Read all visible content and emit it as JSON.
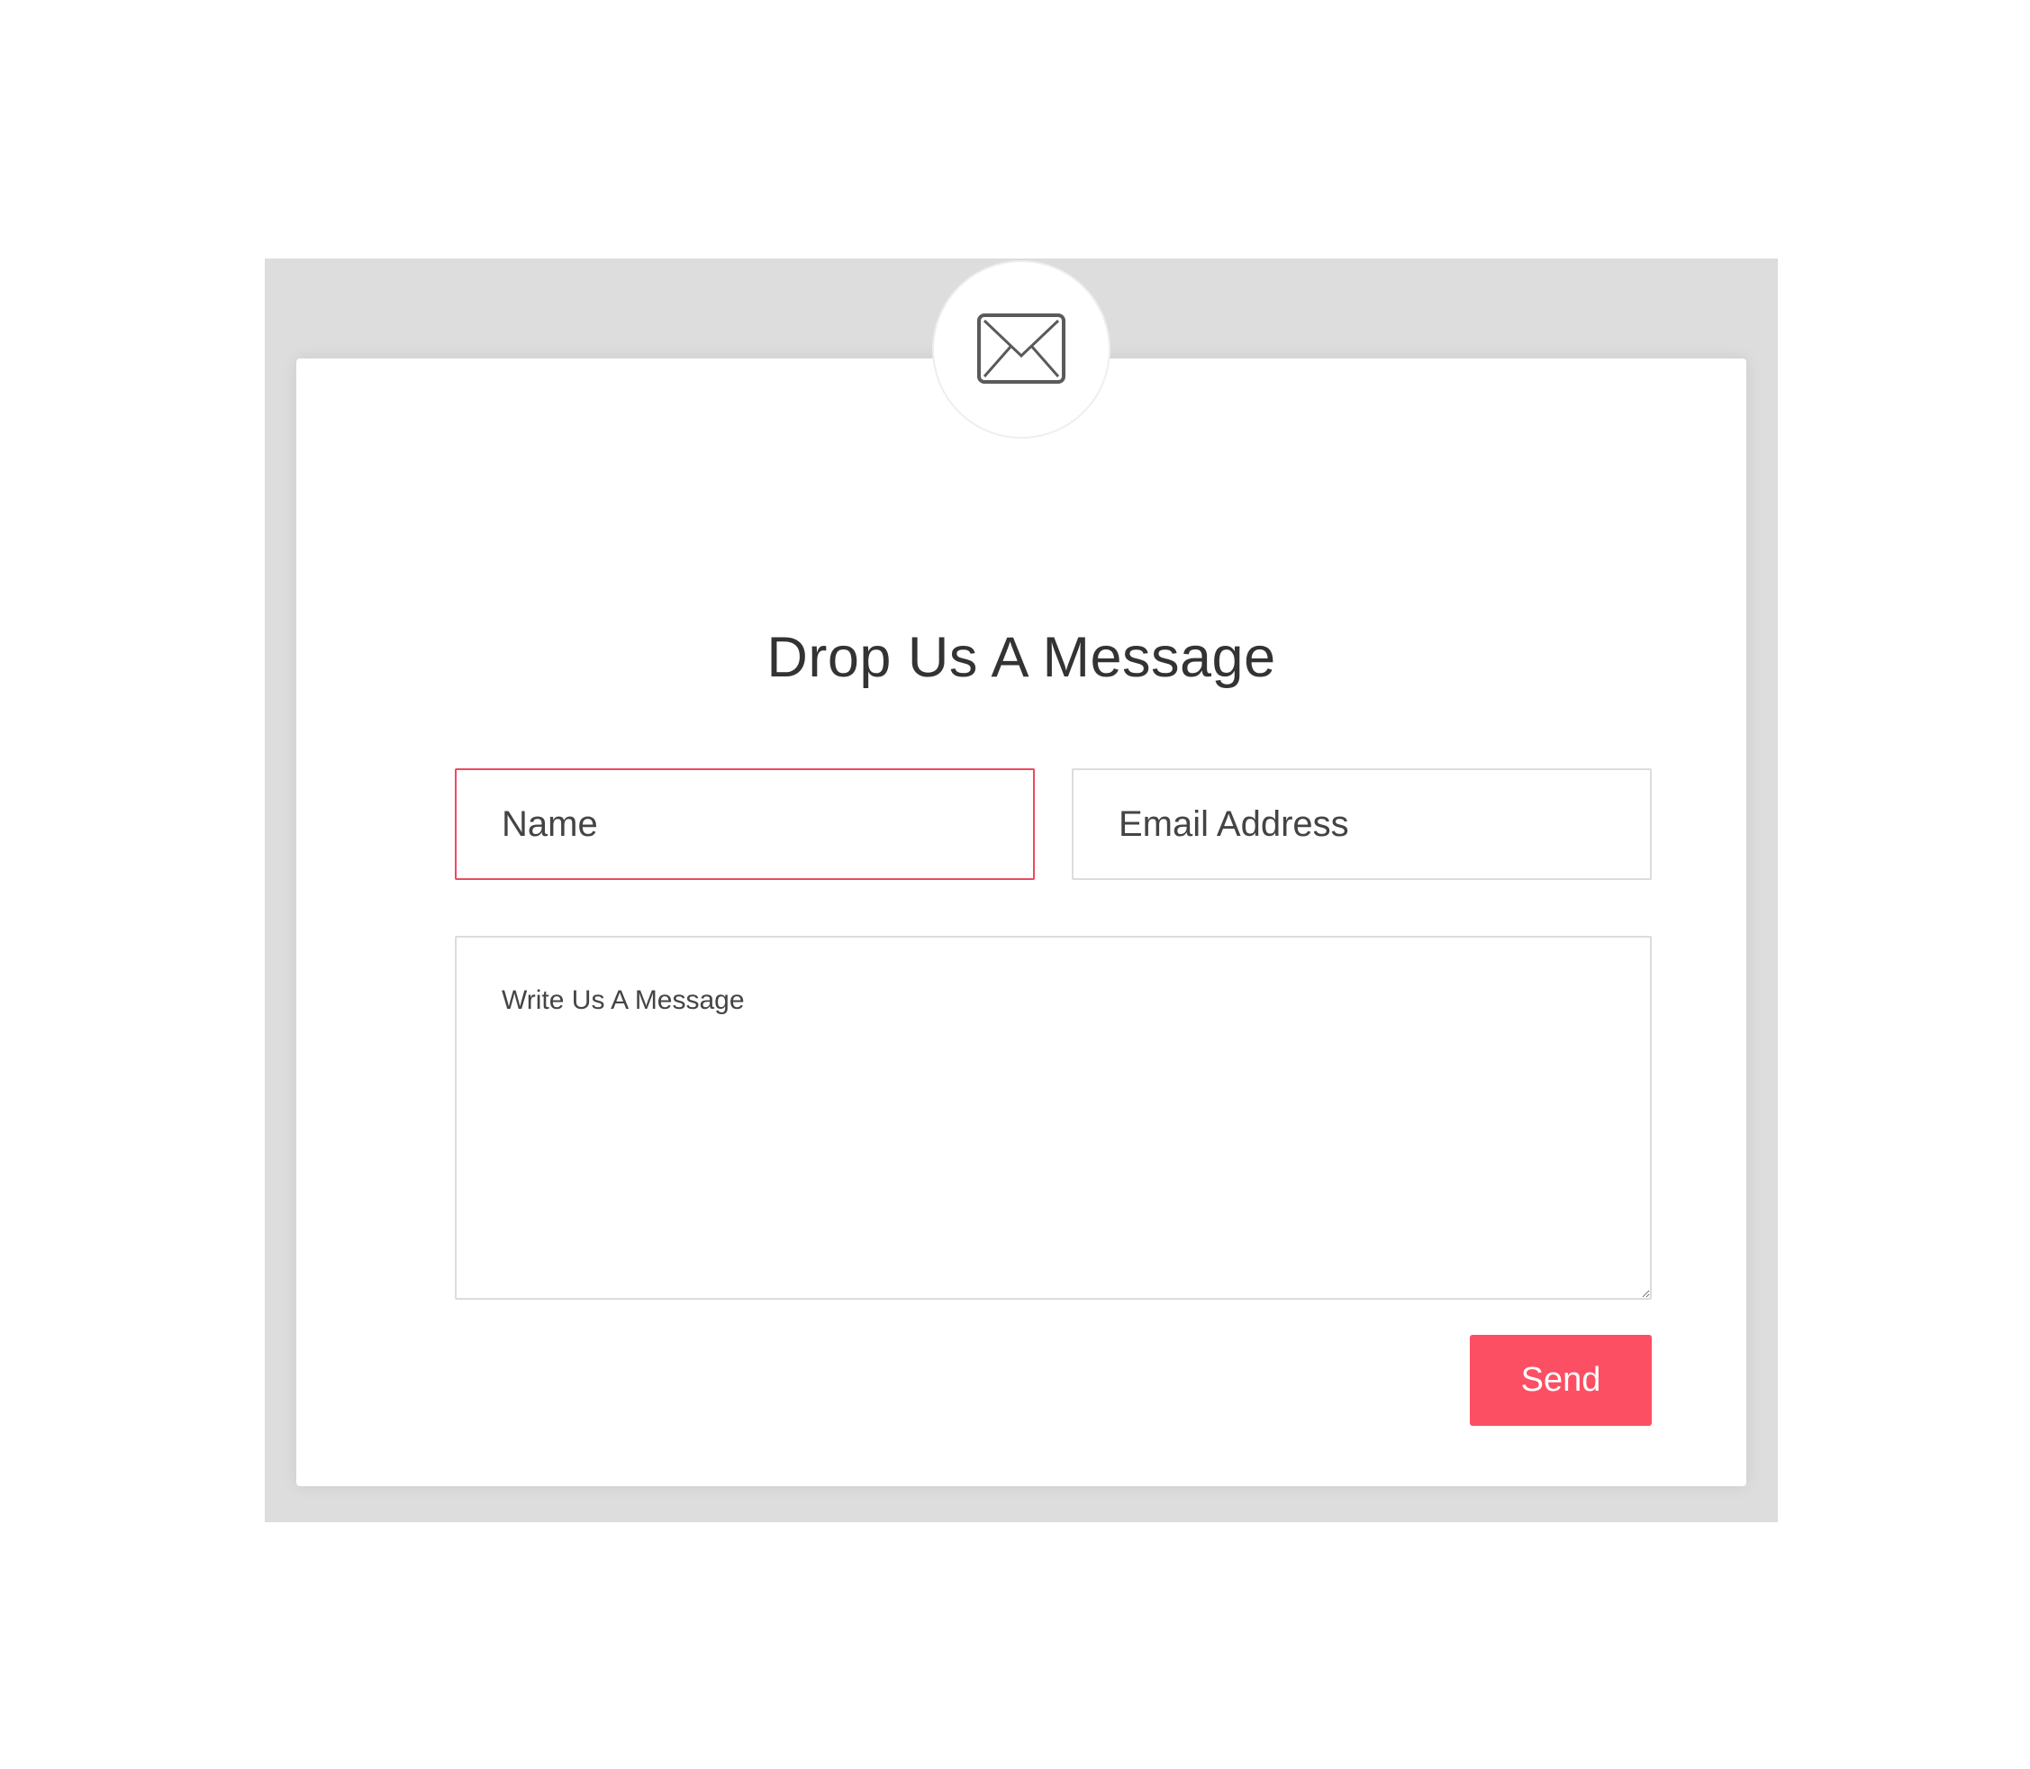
{
  "contact_form": {
    "icon": "envelope-icon",
    "title": "Drop Us A Message",
    "name_placeholder": "Name",
    "email_placeholder": "Email Address",
    "message_placeholder": "Write Us A Message",
    "send_label": "Send"
  },
  "colors": {
    "accent": "#fd4f63",
    "invalid_border": "#f04860",
    "frame_background": "#dddddd",
    "card_background": "#ffffff",
    "text": "#333333"
  }
}
